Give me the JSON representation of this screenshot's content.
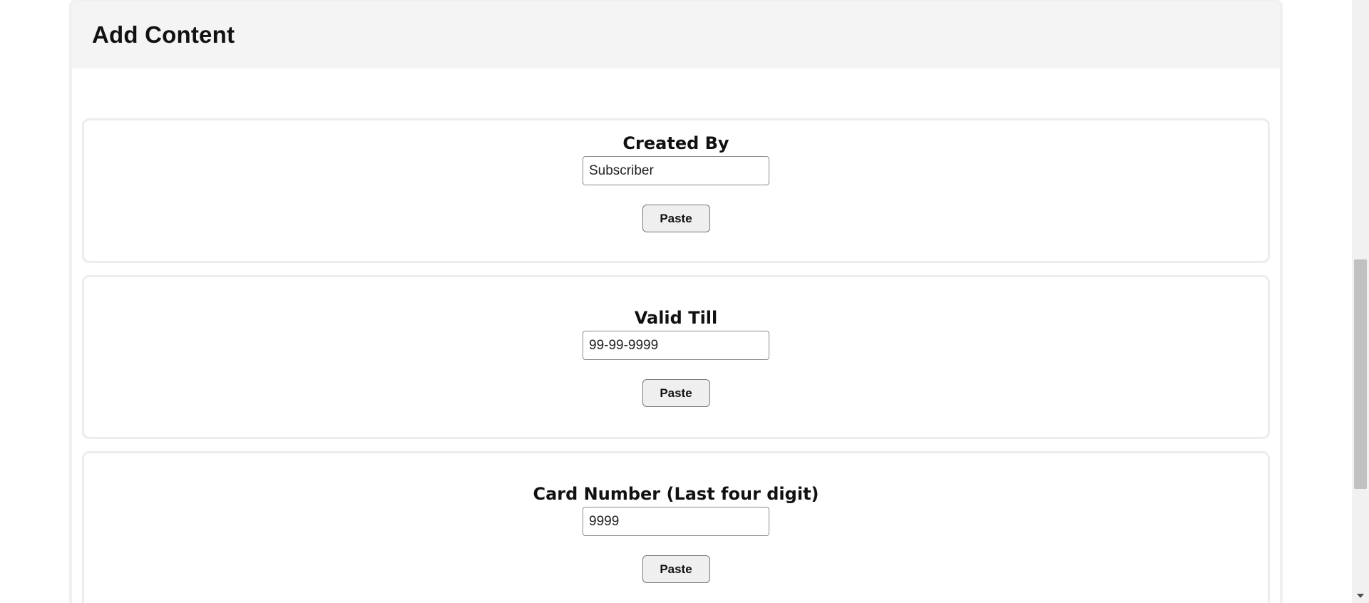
{
  "header": {
    "title": "Add Content"
  },
  "fields": [
    {
      "label": "Created By",
      "value": "Subscriber",
      "button_label": "Paste"
    },
    {
      "label": "Valid Till",
      "value": "99-99-9999",
      "button_label": "Paste"
    },
    {
      "label": "Card Number (Last four digit)",
      "value": "9999",
      "button_label": "Paste"
    }
  ],
  "colors": {
    "background": "#ffffff",
    "header_background": "#f4f4f4",
    "card_border": "#ececec",
    "button_background": "#efefef",
    "text": "#111111"
  }
}
